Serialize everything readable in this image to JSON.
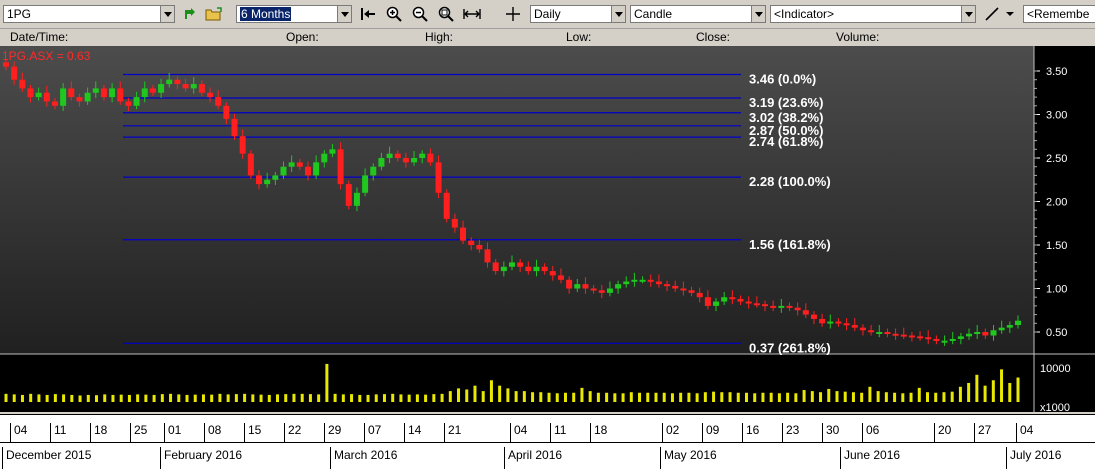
{
  "toolbar": {
    "symbol": "1PG",
    "period": "6 Months",
    "interval": "Daily",
    "chart_style": "Candle",
    "indicator": "<Indicator>",
    "remember": "<Remembe"
  },
  "header": {
    "date_time": "Date/Time:",
    "open": "Open:",
    "high": "High:",
    "low": "Low:",
    "close": "Close:",
    "volume": "Volume:"
  },
  "chart": {
    "series_label": "1PG.ASX = 0.63",
    "colors": {
      "up": "#1fc71f",
      "down": "#ff1f1f",
      "fib": "#0000cc",
      "volume": "#e8e800",
      "grid_text": "#ffffff"
    },
    "price_ticks": [
      "3.50",
      "3.00",
      "2.50",
      "2.00",
      "1.50",
      "1.00",
      "0.50"
    ],
    "volume_ticks": [
      "10000",
      "x1000"
    ],
    "fib_levels": [
      {
        "price": 3.46,
        "label": "3.46 (0.0%)"
      },
      {
        "price": 3.19,
        "label": "3.19 (23.6%)"
      },
      {
        "price": 3.02,
        "label": "3.02 (38.2%)"
      },
      {
        "price": 2.87,
        "label": "2.87 (50.0%)"
      },
      {
        "price": 2.74,
        "label": "2.74 (61.8%)"
      },
      {
        "price": 2.28,
        "label": "2.28 (100.0%)"
      },
      {
        "price": 1.56,
        "label": "1.56 (161.8%)"
      },
      {
        "price": 0.37,
        "label": "0.37 (261.8%)"
      }
    ]
  },
  "chart_data": {
    "type": "candlestick",
    "title": "1PG.ASX = 0.63",
    "ylim": [
      0.28,
      3.66
    ],
    "close": [
      3.55,
      3.4,
      3.3,
      3.2,
      3.25,
      3.15,
      3.1,
      3.3,
      3.2,
      3.15,
      3.25,
      3.3,
      3.2,
      3.3,
      3.15,
      3.1,
      3.2,
      3.3,
      3.25,
      3.35,
      3.4,
      3.35,
      3.3,
      3.35,
      3.25,
      3.2,
      3.1,
      2.95,
      2.75,
      2.55,
      2.3,
      2.2,
      2.25,
      2.3,
      2.4,
      2.45,
      2.4,
      2.3,
      2.45,
      2.55,
      2.6,
      2.2,
      1.95,
      2.1,
      2.3,
      2.4,
      2.5,
      2.55,
      2.5,
      2.45,
      2.5,
      2.55,
      2.45,
      2.1,
      1.8,
      1.7,
      1.55,
      1.5,
      1.45,
      1.3,
      1.2,
      1.25,
      1.3,
      1.25,
      1.2,
      1.25,
      1.2,
      1.15,
      1.1,
      1.0,
      1.05,
      1.0,
      0.98,
      0.95,
      1.0,
      1.05,
      1.08,
      1.1,
      1.1,
      1.08,
      1.05,
      1.03,
      1.0,
      0.98,
      0.95,
      0.9,
      0.8,
      0.85,
      0.9,
      0.88,
      0.85,
      0.83,
      0.82,
      0.8,
      0.78,
      0.8,
      0.78,
      0.75,
      0.7,
      0.65,
      0.6,
      0.62,
      0.6,
      0.58,
      0.55,
      0.52,
      0.5,
      0.5,
      0.48,
      0.47,
      0.46,
      0.45,
      0.44,
      0.42,
      0.4,
      0.4,
      0.42,
      0.45,
      0.48,
      0.5,
      0.46,
      0.52,
      0.55,
      0.58,
      0.63
    ],
    "volume": [
      1500,
      1400,
      1300,
      1500,
      1400,
      1300,
      1450,
      1400,
      1300,
      1200,
      1300,
      1250,
      1400,
      1300,
      1350,
      1300,
      1400,
      1350,
      1300,
      1450,
      1500,
      1400,
      1300,
      1350,
      1400,
      1350,
      1500,
      1400,
      1450,
      1500,
      1400,
      1350,
      1300,
      1400,
      1450,
      1500,
      1500,
      1450,
      1400,
      7000,
      1500,
      1400,
      1450,
      1300,
      1300,
      1400,
      1450,
      1500,
      1400,
      1350,
      1400,
      1350,
      1450,
      1500,
      2000,
      2500,
      2300,
      3000,
      2000,
      4000,
      3000,
      2500,
      2000,
      2000,
      1800,
      1800,
      1700,
      1600,
      1700,
      1700,
      2600,
      2000,
      1700,
      1700,
      1600,
      1600,
      1800,
      1700,
      1700,
      1700,
      1700,
      1600,
      1700,
      1700,
      1600,
      1800,
      1900,
      1800,
      1800,
      1700,
      1700,
      1600,
      1700,
      1700,
      1600,
      1700,
      1600,
      2200,
      2000,
      1800,
      2400,
      2000,
      1900,
      1800,
      1700,
      2800,
      2000,
      1800,
      1700,
      1600,
      1700,
      2600,
      1800,
      1700,
      1800,
      1900,
      2800,
      3500,
      5000,
      3000,
      4000,
      6000,
      3500,
      4500
    ]
  },
  "axis": {
    "days": [
      "04",
      "11",
      "18",
      "25",
      "01",
      "08",
      "15",
      "22",
      "29",
      "07",
      "14",
      "21",
      "04",
      "11",
      "18",
      "02",
      "09",
      "16",
      "23",
      "30",
      "06",
      "20",
      "27",
      "04"
    ],
    "months": [
      "December 2015",
      "February 2016",
      "March 2016",
      "April 2016",
      "May 2016",
      "June 2016",
      "July 2016"
    ]
  }
}
